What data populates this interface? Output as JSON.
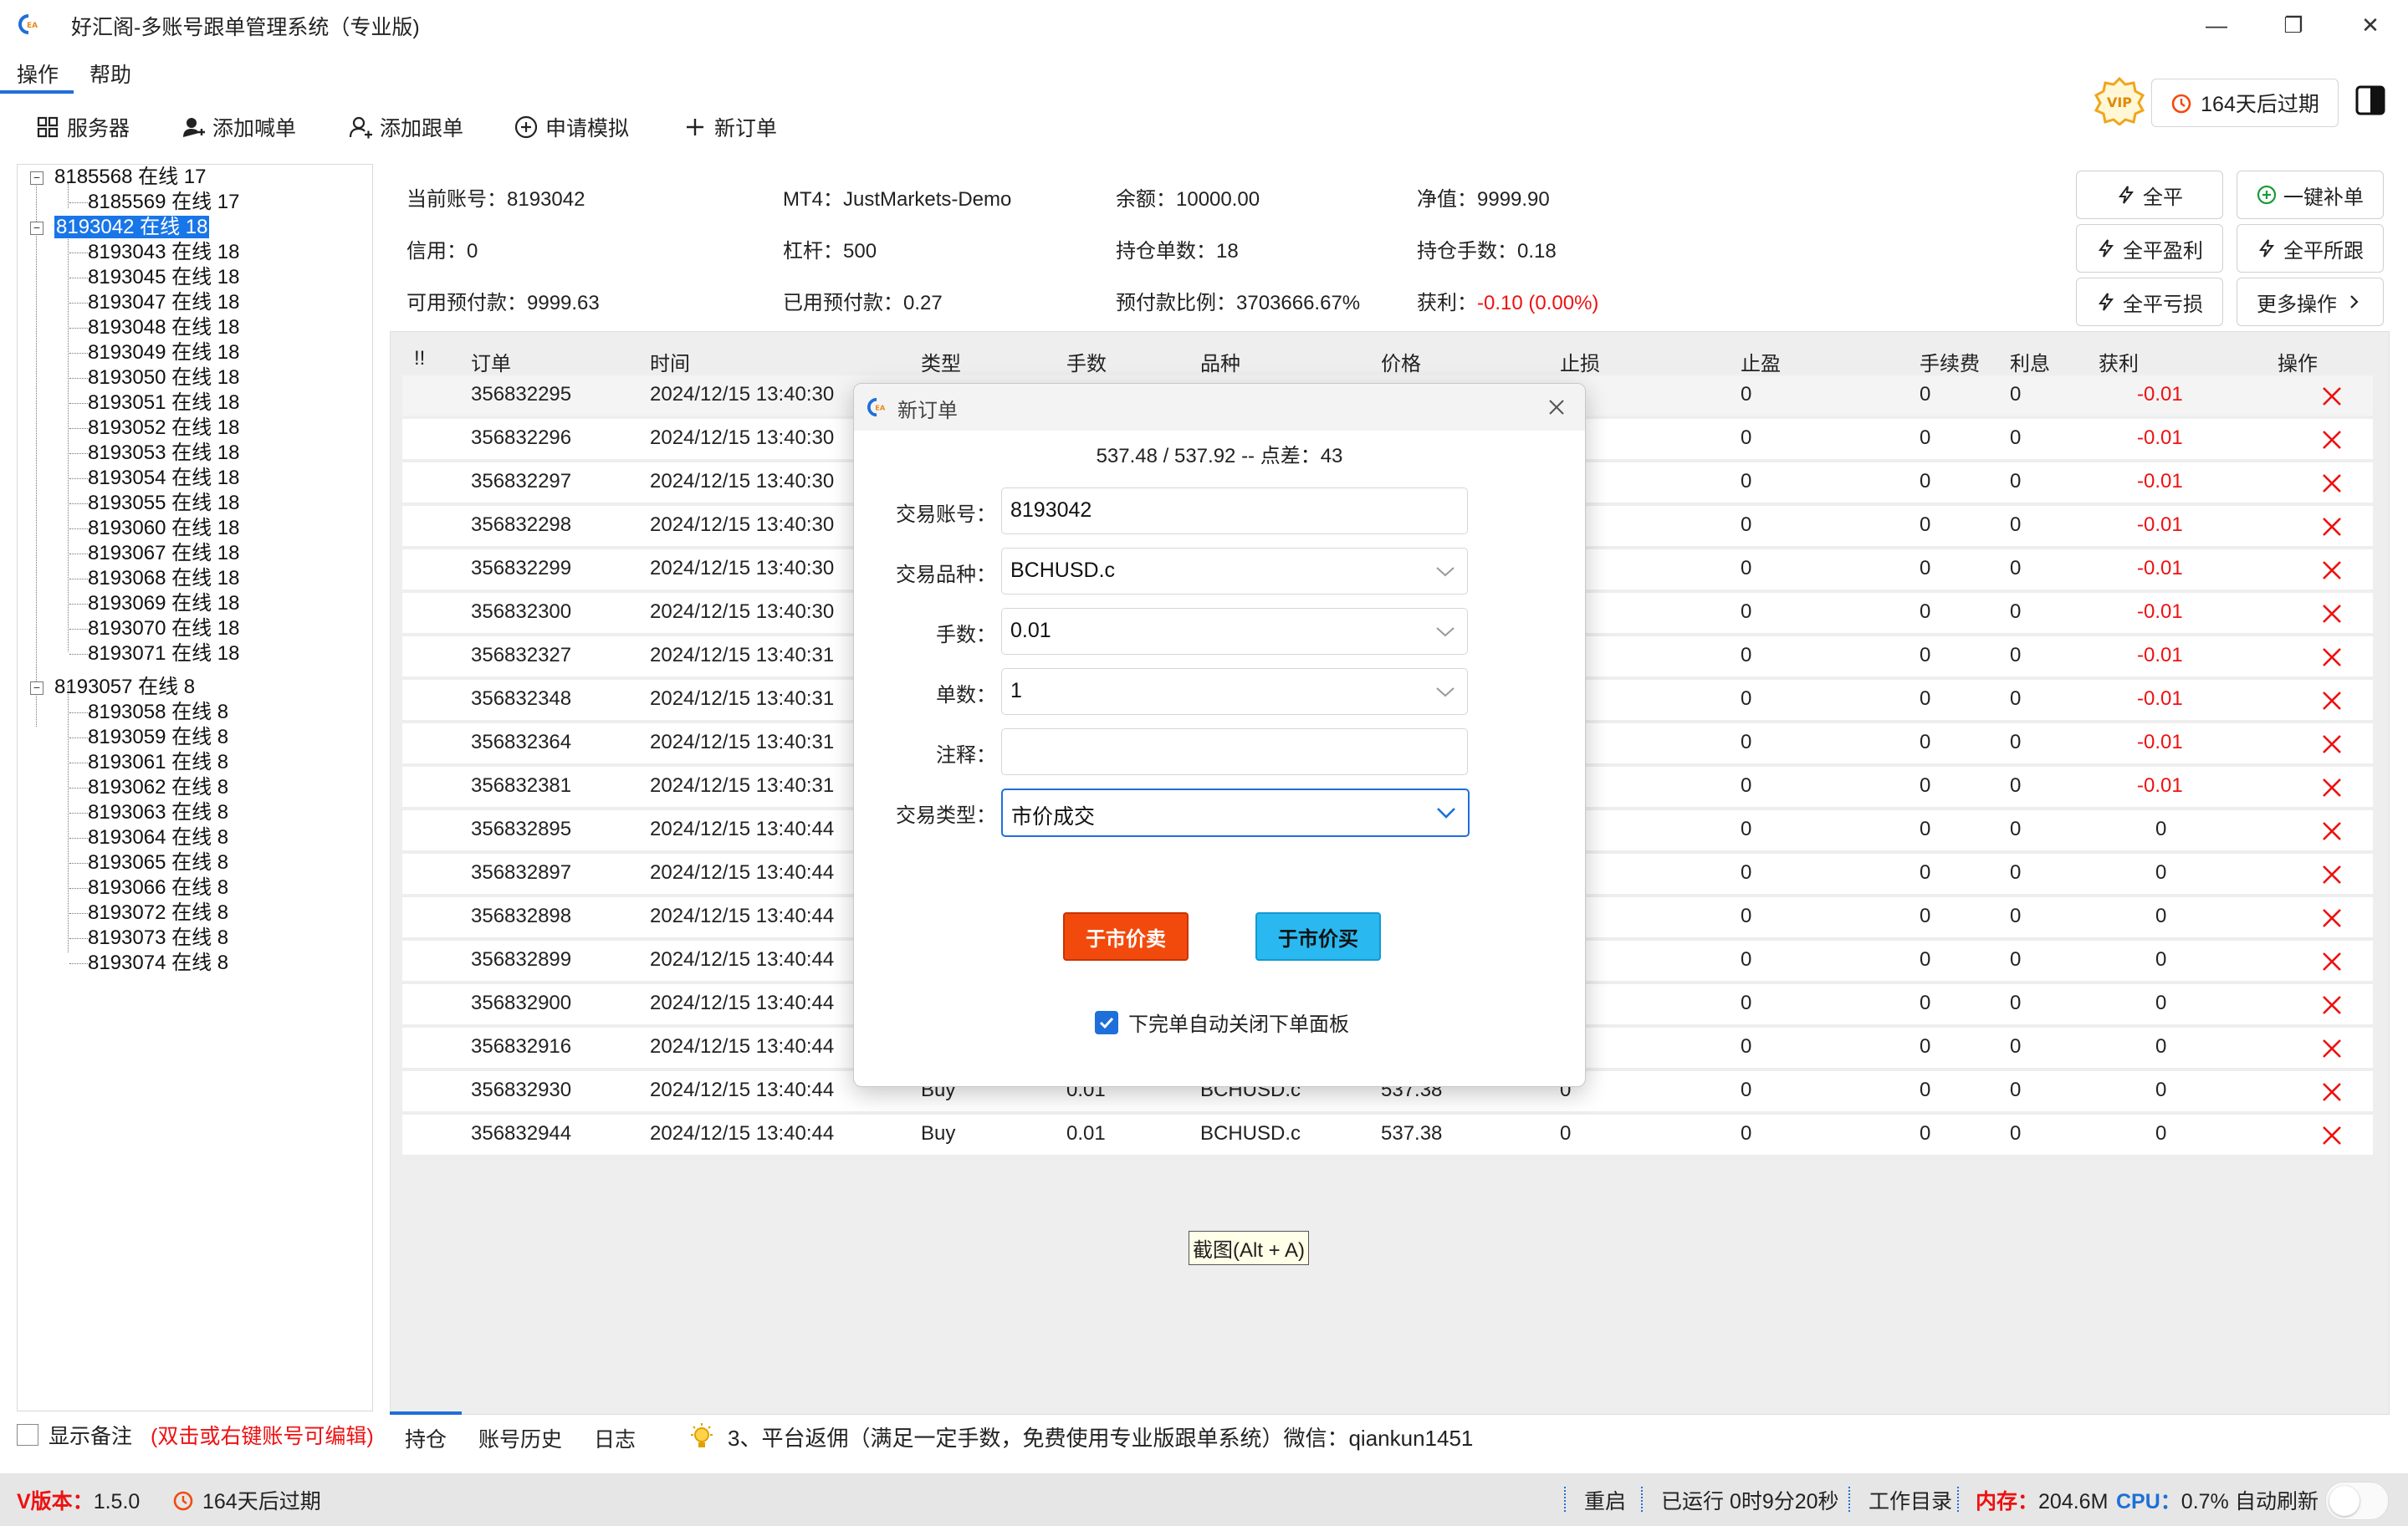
{
  "window": {
    "title": "好汇阁-多账号跟单管理系统（专业版)",
    "min_glyph": "—",
    "max_glyph": "❐",
    "close_glyph": "✕"
  },
  "menu": {
    "items": [
      "操作",
      "帮助"
    ]
  },
  "toolbar": {
    "items": [
      "服务器",
      "添加喊单",
      "添加跟单",
      "申请模拟",
      "新订单"
    ]
  },
  "vip": {
    "label": "VIP",
    "expire": "164天后过期"
  },
  "tree": {
    "groups": [
      {
        "label": "8185568 在线 17",
        "children": [
          "8185569 在线 17"
        ]
      },
      {
        "label": "8193042 在线 18",
        "children": [
          "8193043 在线 18",
          "8193045 在线 18",
          "8193047 在线 18",
          "8193048 在线 18",
          "8193049 在线 18",
          "8193050 在线 18",
          "8193051 在线 18",
          "8193052 在线 18",
          "8193053 在线 18",
          "8193054 在线 18",
          "8193055 在线 18",
          "8193060 在线 18",
          "8193067 在线 18",
          "8193068 在线 18",
          "8193069 在线 18",
          "8193070 在线 18",
          "8193071 在线 18"
        ]
      },
      {
        "label": "8193057 在线 8",
        "children": [
          "8193058 在线 8",
          "8193059 在线 8",
          "8193061 在线 8",
          "8193062 在线 8",
          "8193063 在线 8",
          "8193064 在线 8",
          "8193065 在线 8",
          "8193066 在线 8",
          "8193072 在线 8",
          "8193073 在线 8",
          "8193074 在线 8"
        ]
      }
    ],
    "show_note": "显示备注",
    "note_hint": "(双击或右键账号可编辑)"
  },
  "info": {
    "current_account": "当前账号：8193042",
    "mt4": "MT4：JustMarkets-Demo",
    "balance": "余额：10000.00",
    "equity": "净值：9999.90",
    "credit": "信用：0",
    "leverage": "杠杆：500",
    "positions": "持仓单数：18",
    "lots": "持仓手数：0.18",
    "free_margin": "可用预付款：9999.63",
    "used_margin": "已用预付款：0.27",
    "margin_ratio": "预付款比例：3703666.67%",
    "profit_label": "获利：",
    "profit_value": "-0.10 (0.00%)"
  },
  "actions": [
    "全平",
    "一键补单",
    "全平盈利",
    "全平所跟",
    "全平亏损",
    "更多操作"
  ],
  "table": {
    "headers": [
      "!!",
      "订单",
      "时间",
      "类型",
      "手数",
      "品种",
      "价格",
      "止损",
      "止盈",
      "手续费",
      "利息",
      "获利",
      "操作"
    ],
    "rows": [
      {
        "order": "356832295",
        "time": "2024/12/15 13:40:30",
        "type": "",
        "lots": "",
        "symbol": "",
        "price": "",
        "sl": "",
        "tp": "0",
        "fee": "0",
        "swap": "0",
        "profit": "-0.01"
      },
      {
        "order": "356832296",
        "time": "2024/12/15 13:40:30",
        "type": "",
        "lots": "",
        "symbol": "",
        "price": "",
        "sl": "",
        "tp": "0",
        "fee": "0",
        "swap": "0",
        "profit": "-0.01"
      },
      {
        "order": "356832297",
        "time": "2024/12/15 13:40:30",
        "type": "",
        "lots": "",
        "symbol": "",
        "price": "",
        "sl": "",
        "tp": "0",
        "fee": "0",
        "swap": "0",
        "profit": "-0.01"
      },
      {
        "order": "356832298",
        "time": "2024/12/15 13:40:30",
        "type": "",
        "lots": "",
        "symbol": "",
        "price": "",
        "sl": "",
        "tp": "0",
        "fee": "0",
        "swap": "0",
        "profit": "-0.01"
      },
      {
        "order": "356832299",
        "time": "2024/12/15 13:40:30",
        "type": "",
        "lots": "",
        "symbol": "",
        "price": "",
        "sl": "",
        "tp": "0",
        "fee": "0",
        "swap": "0",
        "profit": "-0.01"
      },
      {
        "order": "356832300",
        "time": "2024/12/15 13:40:30",
        "type": "",
        "lots": "",
        "symbol": "",
        "price": "",
        "sl": "",
        "tp": "0",
        "fee": "0",
        "swap": "0",
        "profit": "-0.01"
      },
      {
        "order": "356832327",
        "time": "2024/12/15 13:40:31",
        "type": "",
        "lots": "",
        "symbol": "",
        "price": "",
        "sl": "",
        "tp": "0",
        "fee": "0",
        "swap": "0",
        "profit": "-0.01"
      },
      {
        "order": "356832348",
        "time": "2024/12/15 13:40:31",
        "type": "",
        "lots": "",
        "symbol": "",
        "price": "",
        "sl": "",
        "tp": "0",
        "fee": "0",
        "swap": "0",
        "profit": "-0.01"
      },
      {
        "order": "356832364",
        "time": "2024/12/15 13:40:31",
        "type": "",
        "lots": "",
        "symbol": "",
        "price": "",
        "sl": "",
        "tp": "0",
        "fee": "0",
        "swap": "0",
        "profit": "-0.01"
      },
      {
        "order": "356832381",
        "time": "2024/12/15 13:40:31",
        "type": "",
        "lots": "",
        "symbol": "",
        "price": "",
        "sl": "",
        "tp": "0",
        "fee": "0",
        "swap": "0",
        "profit": "-0.01"
      },
      {
        "order": "356832895",
        "time": "2024/12/15 13:40:44",
        "type": "",
        "lots": "",
        "symbol": "",
        "price": "",
        "sl": "",
        "tp": "0",
        "fee": "0",
        "swap": "0",
        "profit": "0"
      },
      {
        "order": "356832897",
        "time": "2024/12/15 13:40:44",
        "type": "",
        "lots": "",
        "symbol": "",
        "price": "",
        "sl": "",
        "tp": "0",
        "fee": "0",
        "swap": "0",
        "profit": "0"
      },
      {
        "order": "356832898",
        "time": "2024/12/15 13:40:44",
        "type": "",
        "lots": "",
        "symbol": "",
        "price": "",
        "sl": "",
        "tp": "0",
        "fee": "0",
        "swap": "0",
        "profit": "0"
      },
      {
        "order": "356832899",
        "time": "2024/12/15 13:40:44",
        "type": "",
        "lots": "",
        "symbol": "",
        "price": "",
        "sl": "",
        "tp": "0",
        "fee": "0",
        "swap": "0",
        "profit": "0"
      },
      {
        "order": "356832900",
        "time": "2024/12/15 13:40:44",
        "type": "",
        "lots": "",
        "symbol": "",
        "price": "",
        "sl": "",
        "tp": "0",
        "fee": "0",
        "swap": "0",
        "profit": "0"
      },
      {
        "order": "356832916",
        "time": "2024/12/15 13:40:44",
        "type": "",
        "lots": "",
        "symbol": "",
        "price": "",
        "sl": "",
        "tp": "0",
        "fee": "0",
        "swap": "0",
        "profit": "0"
      },
      {
        "order": "356832930",
        "time": "2024/12/15 13:40:44",
        "type": "Buy",
        "lots": "0.01",
        "symbol": "BCHUSD.c",
        "price": "537.38",
        "sl": "0",
        "tp": "0",
        "fee": "0",
        "swap": "0",
        "profit": "0"
      },
      {
        "order": "356832944",
        "time": "2024/12/15 13:40:44",
        "type": "Buy",
        "lots": "0.01",
        "symbol": "BCHUSD.c",
        "price": "537.38",
        "sl": "0",
        "tp": "0",
        "fee": "0",
        "swap": "0",
        "profit": "0"
      }
    ]
  },
  "bottom_tabs": [
    "持仓",
    "账号历史",
    "日志"
  ],
  "notice": "3、平台返佣（满足一定手数，免费使用专业版跟单系统）微信：qiankun1451",
  "screenshot_hint": "截图(Alt + A)",
  "status": {
    "version_label": "V版本：",
    "version": "1.5.0",
    "expire": "164天后过期",
    "restart": "重启",
    "uptime": "已运行 0时9分20秒",
    "workdir": "工作目录",
    "mem_label": "内存：",
    "mem": "204.6M",
    "cpu_label": "CPU：",
    "cpu": "0.7%",
    "auto_refresh": "自动刷新"
  },
  "dialog": {
    "title": "新订单",
    "quote": "537.48 / 537.92 -- 点差：43",
    "account_label": "交易账号：",
    "account_value": "8193042",
    "symbol_label": "交易品种：",
    "symbol_value": "BCHUSD.c",
    "lots_label": "手数：",
    "lots_value": "0.01",
    "count_label": "单数：",
    "count_value": "1",
    "comment_label": "注释：",
    "comment_value": "",
    "type_label": "交易类型：",
    "type_value": "市价成交",
    "sell_label": "于市价卖",
    "buy_label": "于市价买",
    "auto_close_label": "下完单自动关闭下单面板"
  },
  "colors": {
    "accent": "#1e6fd9",
    "sell": "#f24a0d",
    "buy": "#29b9f0",
    "loss": "#e11111"
  }
}
